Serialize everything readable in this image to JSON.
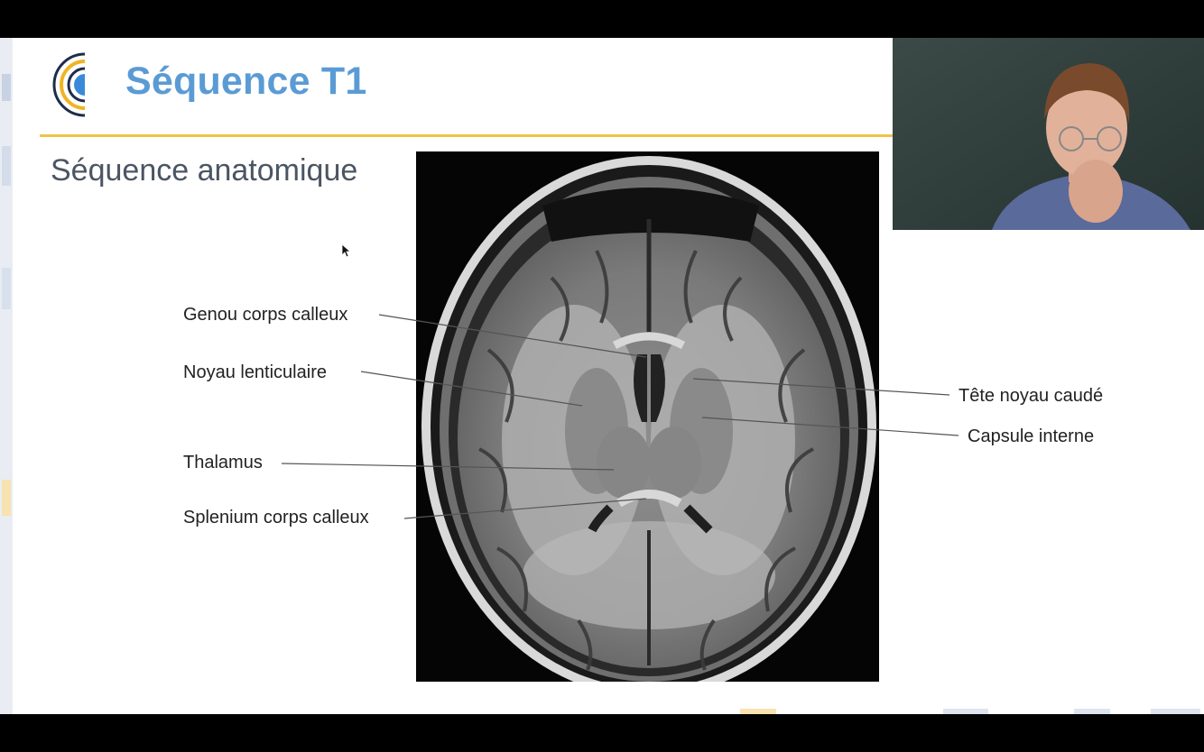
{
  "slide": {
    "title": "Séquence T1",
    "subtitle": "Séquence anatomique"
  },
  "labels": {
    "genou": "Genou corps calleux",
    "noyau_lenticulaire": "Noyau lenticulaire",
    "thalamus": "Thalamus",
    "splenium": "Splenium corps calleux",
    "tete_noyau_caude": "Tête noyau caudé",
    "capsule_interne": "Capsule interne"
  },
  "image": {
    "kind": "axial T1-weighted brain MRI"
  },
  "overlay": {
    "webcam": "presenter webcam"
  },
  "colors": {
    "title": "#5b9bd5",
    "rule": "#f0c34a",
    "subtitle": "#4b5563"
  }
}
